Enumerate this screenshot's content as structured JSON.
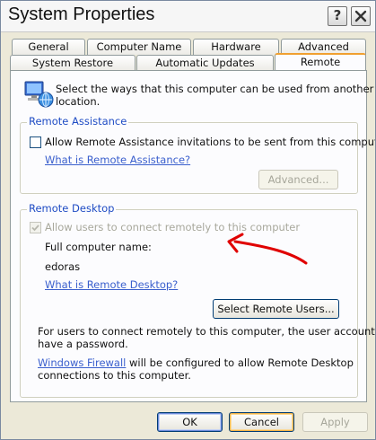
{
  "window": {
    "title": "System Properties",
    "help_label": "?",
    "close_label": "X"
  },
  "tabs_row_back": [
    "General",
    "Computer Name",
    "Hardware",
    "Advanced"
  ],
  "tabs_row_front": [
    "System Restore",
    "Automatic Updates",
    "Remote"
  ],
  "active_tab": "Remote",
  "intro": {
    "text_line1": "Select the ways that this computer can be used from another",
    "text_line2": "location."
  },
  "remote_assistance": {
    "legend": "Remote Assistance",
    "checkbox_label": "Allow Remote Assistance invitations to be sent from this computer",
    "checked": false,
    "help_link": "What is Remote Assistance?",
    "advanced_button": "Advanced...",
    "advanced_enabled": false
  },
  "remote_desktop": {
    "legend": "Remote Desktop",
    "checkbox_label": "Allow users to connect remotely to this computer",
    "checked": true,
    "checkbox_enabled": false,
    "computer_name_label": "Full computer name:",
    "computer_name_value": "edoras",
    "help_link": "What is Remote Desktop?",
    "select_users_button": "Select Remote Users...",
    "note_line1": "For users to connect remotely to this computer, the user account must",
    "note_line2": "have a password.",
    "firewall_link": "Windows Firewall",
    "firewall_text_line1": " will be configured to allow Remote Desktop",
    "firewall_text_line2": "connections to this computer."
  },
  "annotation": {
    "color": "#e00000"
  },
  "footer": {
    "ok": "OK",
    "cancel": "Cancel",
    "apply": "Apply",
    "apply_enabled": false
  }
}
